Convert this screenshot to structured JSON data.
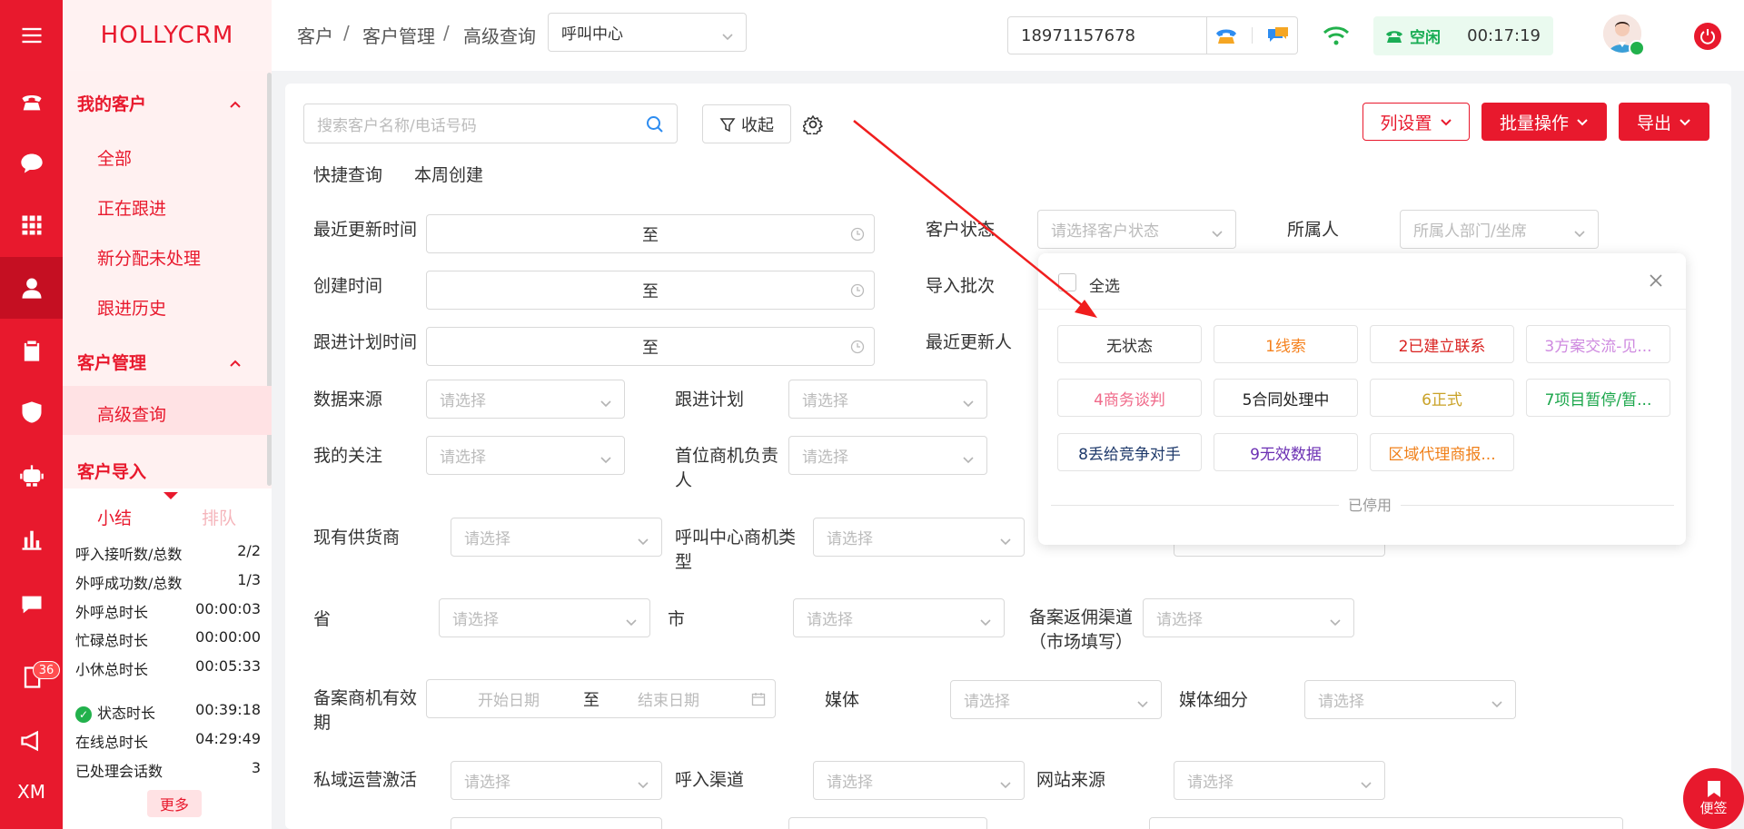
{
  "sidebar": {
    "badge": "36",
    "footer_text": "XM"
  },
  "brand": "HOLLYCRM",
  "nav": {
    "group1": "我的客户",
    "items1": [
      "全部",
      "正在跟进",
      "新分配未处理",
      "跟进历史"
    ],
    "group2": "客户管理",
    "items2": [
      "高级查询"
    ],
    "group3": "客户导入"
  },
  "stats": {
    "tab_active": "小结",
    "tab_inactive": "排队",
    "rows": [
      {
        "label": "呼入接听数/总数",
        "value": "2/2"
      },
      {
        "label": "外呼成功数/总数",
        "value": "1/3"
      },
      {
        "label": "外呼总时长",
        "value": "00:00:03"
      },
      {
        "label": "忙碌总时长",
        "value": "00:00:00"
      },
      {
        "label": "小休总时长",
        "value": "00:05:33"
      },
      {
        "label": "状态时长",
        "value": "00:39:18"
      },
      {
        "label": "在线总时长",
        "value": "04:29:49"
      },
      {
        "label": "已处理会话数",
        "value": "3"
      }
    ],
    "more": "更多"
  },
  "header": {
    "crumbs": [
      "客户",
      "客户管理",
      "高级查询"
    ],
    "separator": "/",
    "channel_select": "呼叫中心",
    "phone_number": "18971157678",
    "status": "空闲",
    "timer": "00:17:19"
  },
  "toolbar": {
    "search_placeholder": "搜索客户名称/电话号码",
    "collapse_label": "收起",
    "column_settings": "列设置",
    "batch_ops": "批量操作",
    "export": "导出"
  },
  "quick": {
    "label": "快捷查询",
    "item": "本周创建"
  },
  "form": {
    "to": "至",
    "select_ph": "请选择",
    "start_ph": "开始日期",
    "end_ph": "结束日期",
    "recent_update_time": "最近更新时间",
    "create_time": "创建时间",
    "follow_plan_time": "跟进计划时间",
    "customer_status": "客户状态",
    "customer_status_ph": "请选择客户状态",
    "owner": "所属人",
    "owner_ph": "所属人部门/坐席",
    "import_batch": "导入批次",
    "recent_updater": "最近更新人",
    "data_source": "数据来源",
    "follow_plan": "跟进计划",
    "my_focus": "我的关注",
    "first_lead_owner": "首位商机负责人",
    "existing_supplier": "现有供货商",
    "callcenter_lead_type": "呼叫中心商机类型",
    "province": "省",
    "city": "市",
    "filing_channel": "备案返佣渠道（市场填写）",
    "filing_validity": "备案商机有效期",
    "media": "媒体",
    "media_sub": "媒体细分",
    "private_activation": "私域运营激活",
    "inbound_channel": "呼入渠道",
    "website_source": "网站来源"
  },
  "popup": {
    "select_all": "全选",
    "disabled_label": "已停用",
    "chips": [
      {
        "label": "无状态",
        "color": "#333333"
      },
      {
        "label": "1线索",
        "color": "#f5821f"
      },
      {
        "label": "2已建立联系",
        "color": "#d9211f"
      },
      {
        "label": "3方案交流-见...",
        "color": "#cf8be0"
      },
      {
        "label": "4商务谈判",
        "color": "#f06a8a"
      },
      {
        "label": "5合同处理中",
        "color": "#222222"
      },
      {
        "label": "6正式",
        "color": "#c9a227"
      },
      {
        "label": "7项目暂停/暂...",
        "color": "#1aa64a"
      },
      {
        "label": "8丢给竞争对手",
        "color": "#1f3a6b"
      },
      {
        "label": "9无效数据",
        "color": "#6b2fb3"
      },
      {
        "label": "区域代理商报...",
        "color": "#f0801a"
      }
    ]
  },
  "float_btn": "便签",
  "colors": {
    "brand_red": "#e8192d",
    "status_green": "#1aad55"
  }
}
